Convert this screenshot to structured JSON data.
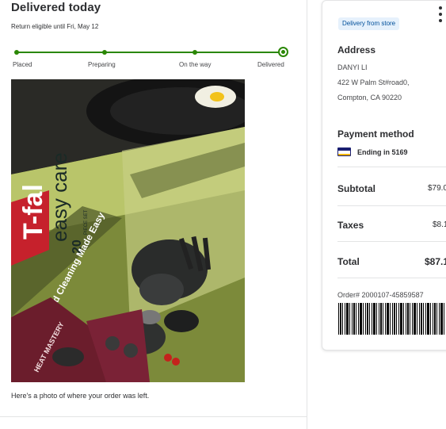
{
  "order_status": {
    "title": "Delivered today",
    "return_note": "Return eligible until Fri, May 12",
    "steps": [
      "Placed",
      "Preparing",
      "On the way",
      "Delivered"
    ],
    "current_step": "Delivered",
    "photo_caption": "Here's a photo of where your order was left.",
    "photo_product": {
      "brand": "T-fal",
      "line": "easy care",
      "piece_count": "20",
      "piece_label": "PIECE SET",
      "tagline": "Cooking and Cleaning Made Easy",
      "badge": "HEAT MASTERY"
    }
  },
  "summary_card": {
    "fulfillment_badge": "Delivery from store",
    "address_heading": "Address",
    "address_name": "DANYI LI",
    "address_line1": "422 W Palm St#road0,",
    "address_line2": "Compton, CA 90220",
    "payment_heading": "Payment method",
    "payment_card": "Ending in 5169",
    "subtotal_label": "Subtotal",
    "subtotal_value": "$79.0",
    "taxes_label": "Taxes",
    "taxes_value": "$8.1",
    "total_label": "Total",
    "total_value": "$87.1",
    "order_number": "Order# 2000107-45859587"
  },
  "icons": [
    "more-vertical-icon",
    "visa-card-icon",
    "barcode-icon"
  ],
  "colors": {
    "progress_green": "#2a8703",
    "badge_bg": "#e6f1fc",
    "badge_text": "#004f9a"
  }
}
